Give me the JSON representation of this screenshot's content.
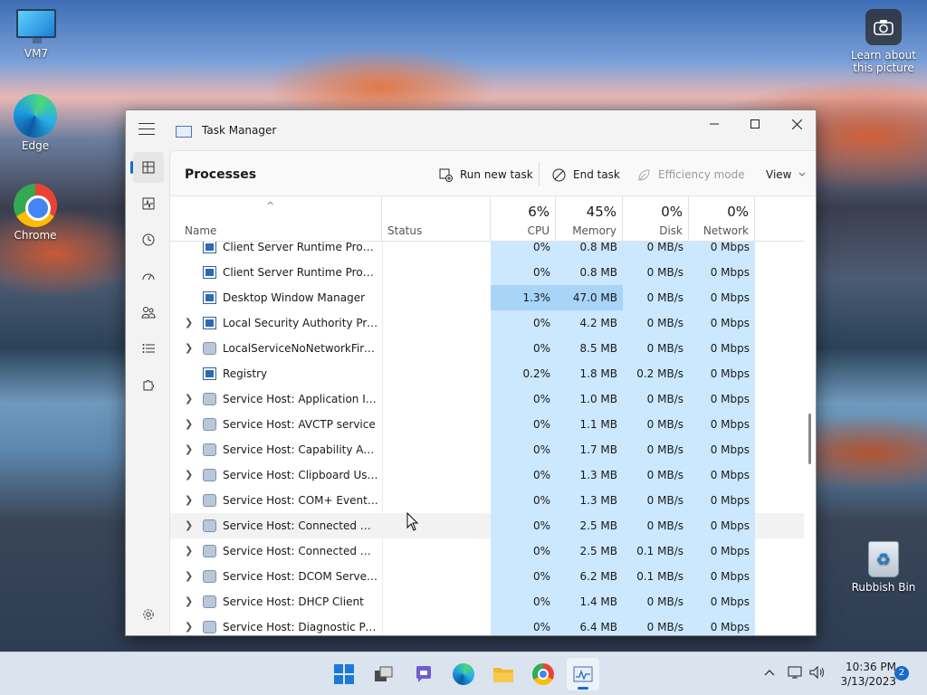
{
  "desktop": {
    "icons": [
      {
        "label": "VM7"
      },
      {
        "label": "Edge"
      },
      {
        "label": "Chrome"
      },
      {
        "label": "Rubbish Bin"
      }
    ],
    "spotlight": {
      "label_line1": "Learn about",
      "label_line2": "this picture"
    }
  },
  "window": {
    "title": "Task Manager",
    "page_title": "Processes",
    "commands": {
      "run_new_task": "Run new task",
      "end_task": "End task",
      "efficiency_mode": "Efficiency mode",
      "view": "View"
    },
    "columns": {
      "name": "Name",
      "status": "Status",
      "cpu_pct": "6%",
      "cpu": "CPU",
      "memory_pct": "45%",
      "memory": "Memory",
      "disk_pct": "0%",
      "disk": "Disk",
      "network_pct": "0%",
      "network": "Network"
    },
    "processes": [
      {
        "name": "Client Server Runtime Process",
        "expandable": false,
        "icon": "window",
        "cpu": "0%",
        "memory": "0.8 MB",
        "disk": "0 MB/s",
        "network": "0 Mbps"
      },
      {
        "name": "Client Server Runtime Process",
        "expandable": false,
        "icon": "window",
        "cpu": "0%",
        "memory": "0.8 MB",
        "disk": "0 MB/s",
        "network": "0 Mbps"
      },
      {
        "name": "Desktop Window Manager",
        "expandable": false,
        "icon": "window",
        "cpu": "1.3%",
        "memory": "47.0 MB",
        "disk": "0 MB/s",
        "network": "0 Mbps",
        "hot": true
      },
      {
        "name": "Local Security Authority Proce...",
        "expandable": true,
        "icon": "window",
        "cpu": "0%",
        "memory": "4.2 MB",
        "disk": "0 MB/s",
        "network": "0 Mbps"
      },
      {
        "name": "LocalServiceNoNetworkFirewa...",
        "expandable": true,
        "icon": "gear",
        "cpu": "0%",
        "memory": "8.5 MB",
        "disk": "0 MB/s",
        "network": "0 Mbps"
      },
      {
        "name": "Registry",
        "expandable": false,
        "icon": "window",
        "cpu": "0.2%",
        "memory": "1.8 MB",
        "disk": "0.2 MB/s",
        "network": "0 Mbps"
      },
      {
        "name": "Service Host: Application Infor...",
        "expandable": true,
        "icon": "gear",
        "cpu": "0%",
        "memory": "1.0 MB",
        "disk": "0 MB/s",
        "network": "0 Mbps"
      },
      {
        "name": "Service Host: AVCTP service",
        "expandable": true,
        "icon": "gear",
        "cpu": "0%",
        "memory": "1.1 MB",
        "disk": "0 MB/s",
        "network": "0 Mbps"
      },
      {
        "name": "Service Host: Capability Acces...",
        "expandable": true,
        "icon": "gear",
        "cpu": "0%",
        "memory": "1.7 MB",
        "disk": "0 MB/s",
        "network": "0 Mbps"
      },
      {
        "name": "Service Host: Clipboard User S...",
        "expandable": true,
        "icon": "gear",
        "cpu": "0%",
        "memory": "1.3 MB",
        "disk": "0 MB/s",
        "network": "0 Mbps"
      },
      {
        "name": "Service Host: COM+ Event Sys...",
        "expandable": true,
        "icon": "gear",
        "cpu": "0%",
        "memory": "1.3 MB",
        "disk": "0 MB/s",
        "network": "0 Mbps"
      },
      {
        "name": "Service Host: Connected Devi...",
        "expandable": true,
        "icon": "gear",
        "cpu": "0%",
        "memory": "2.5 MB",
        "disk": "0 MB/s",
        "network": "0 Mbps",
        "hover": true
      },
      {
        "name": "Service Host: Connected Devi...",
        "expandable": true,
        "icon": "gear",
        "cpu": "0%",
        "memory": "2.5 MB",
        "disk": "0.1 MB/s",
        "network": "0 Mbps"
      },
      {
        "name": "Service Host: DCOM Server Pr...",
        "expandable": true,
        "icon": "gear",
        "cpu": "0%",
        "memory": "6.2 MB",
        "disk": "0.1 MB/s",
        "network": "0 Mbps"
      },
      {
        "name": "Service Host: DHCP Client",
        "expandable": true,
        "icon": "gear",
        "cpu": "0%",
        "memory": "1.4 MB",
        "disk": "0 MB/s",
        "network": "0 Mbps"
      },
      {
        "name": "Service Host: Diagnostic Polic...",
        "expandable": true,
        "icon": "gear",
        "cpu": "0%",
        "memory": "6.4 MB",
        "disk": "0 MB/s",
        "network": "0 Mbps"
      }
    ]
  },
  "taskbar": {
    "time": "10:36 PM",
    "date": "3/13/2023",
    "notification_count": "2"
  }
}
